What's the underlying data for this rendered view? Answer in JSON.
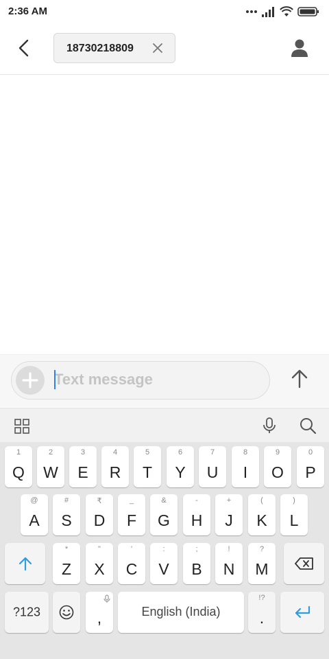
{
  "status": {
    "time": "2:36 AM"
  },
  "header": {
    "recipient": "18730218809"
  },
  "compose": {
    "placeholder": "Text message"
  },
  "keyboard": {
    "row1": [
      {
        "k": "Q",
        "h": "1"
      },
      {
        "k": "W",
        "h": "2"
      },
      {
        "k": "E",
        "h": "3"
      },
      {
        "k": "R",
        "h": "4"
      },
      {
        "k": "T",
        "h": "5"
      },
      {
        "k": "Y",
        "h": "6"
      },
      {
        "k": "U",
        "h": "7"
      },
      {
        "k": "I",
        "h": "8"
      },
      {
        "k": "O",
        "h": "9"
      },
      {
        "k": "P",
        "h": "0"
      }
    ],
    "row2": [
      {
        "k": "A",
        "h": "@"
      },
      {
        "k": "S",
        "h": "#"
      },
      {
        "k": "D",
        "h": "₹"
      },
      {
        "k": "F",
        "h": "_"
      },
      {
        "k": "G",
        "h": "&"
      },
      {
        "k": "H",
        "h": "-"
      },
      {
        "k": "J",
        "h": "+"
      },
      {
        "k": "K",
        "h": "("
      },
      {
        "k": "L",
        "h": ")"
      }
    ],
    "row3": [
      {
        "k": "Z",
        "h": "*"
      },
      {
        "k": "X",
        "h": "\""
      },
      {
        "k": "C",
        "h": "'"
      },
      {
        "k": "V",
        "h": ":"
      },
      {
        "k": "B",
        "h": ";"
      },
      {
        "k": "N",
        "h": "!"
      },
      {
        "k": "M",
        "h": "?"
      }
    ],
    "sym_label": "?123",
    "comma": ",",
    "space_label": "English (India)",
    "period": ".",
    "period_hint": "!?"
  },
  "colors": {
    "accent": "#2F9BE0",
    "caret": "#2F80ED"
  }
}
